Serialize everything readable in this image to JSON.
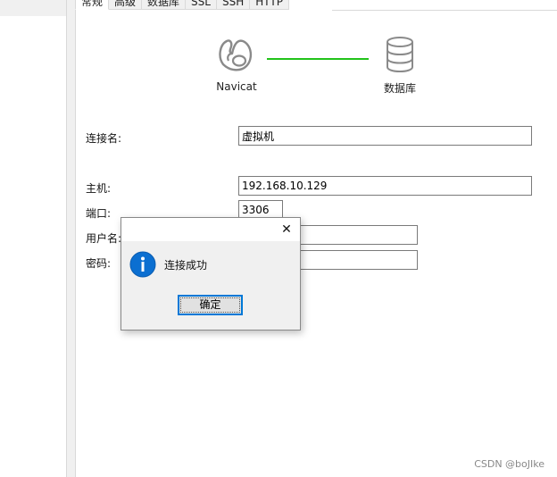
{
  "tabs": [
    {
      "label": "常规",
      "active": true
    },
    {
      "label": "高级",
      "active": false
    },
    {
      "label": "数据库",
      "active": false
    },
    {
      "label": "SSL",
      "active": false
    },
    {
      "label": "SSH",
      "active": false
    },
    {
      "label": "HTTP",
      "active": false
    }
  ],
  "diagram": {
    "client_label": "Navicat",
    "server_label": "数据库",
    "connection_color": "#22c31a"
  },
  "form": {
    "connection_name_label": "连接名:",
    "connection_name_value": "虚拟机",
    "host_label": "主机:",
    "host_value": "192.168.10.129",
    "port_label": "端口:",
    "port_value": "3306",
    "username_label": "用户名:",
    "username_value": "",
    "password_label": "密码:",
    "password_value": ""
  },
  "dialog": {
    "message": "连接成功",
    "ok_label": "确定",
    "close_glyph": "✕",
    "icon": "info-icon",
    "accent_color": "#0078d7"
  },
  "watermark": "CSDN @boJIke"
}
